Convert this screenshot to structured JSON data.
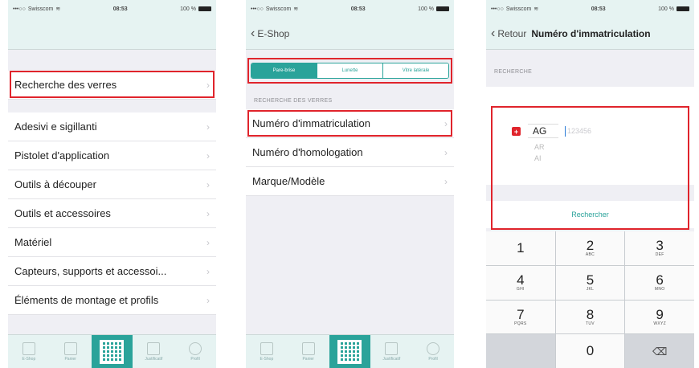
{
  "colors": {
    "accent": "#2aa39a",
    "highlight": "#e0242c",
    "bar_bg": "#e6f3f2"
  },
  "status": {
    "carrier": "Swisscom",
    "time": "08:53",
    "battery": "100 %"
  },
  "screen1": {
    "items": [
      {
        "label": "Recherche des verres"
      },
      {
        "label": "Adesivi e sigillanti"
      },
      {
        "label": "Pistolet d'application"
      },
      {
        "label": "Outils à découper"
      },
      {
        "label": "Outils et accessoires"
      },
      {
        "label": "Matériel"
      },
      {
        "label": "Capteurs, supports et accessoi..."
      },
      {
        "label": "Éléments de montage et profils"
      }
    ],
    "tabs": [
      {
        "label": "E-Shop",
        "icon": "shop-icon"
      },
      {
        "label": "Panier",
        "icon": "bag-icon"
      },
      {
        "label": "",
        "icon": "qr-code-icon"
      },
      {
        "label": "Justificatif",
        "icon": "receipt-icon"
      },
      {
        "label": "Profil",
        "icon": "profile-icon"
      }
    ]
  },
  "screen2": {
    "back_label": "E-Shop",
    "segments": [
      "Pare-brise",
      "Lunette",
      "Vitre latérale"
    ],
    "section_header": "RECHERCHE DES VERRES",
    "items": [
      {
        "label": "Numéro d'immatriculation"
      },
      {
        "label": "Numéro d'homologation"
      },
      {
        "label": "Marque/Modèle"
      }
    ]
  },
  "screen3": {
    "back_label": "Retour",
    "title": "Numéro d'immatriculation",
    "section_header": "RECHERCHE",
    "flag_symbol": "+",
    "canton_selected": "AG",
    "canton_options": [
      "AR",
      "AI"
    ],
    "plate_placeholder": "123456",
    "search_button": "Rechercher",
    "keys": [
      {
        "digit": "1",
        "letters": ""
      },
      {
        "digit": "2",
        "letters": "ABC"
      },
      {
        "digit": "3",
        "letters": "DEF"
      },
      {
        "digit": "4",
        "letters": "GHI"
      },
      {
        "digit": "5",
        "letters": "JKL"
      },
      {
        "digit": "6",
        "letters": "MNO"
      },
      {
        "digit": "7",
        "letters": "PQRS"
      },
      {
        "digit": "8",
        "letters": "TUV"
      },
      {
        "digit": "9",
        "letters": "WXYZ"
      },
      {
        "digit": "",
        "letters": ""
      },
      {
        "digit": "0",
        "letters": ""
      },
      {
        "digit": "⌫",
        "letters": ""
      }
    ]
  }
}
